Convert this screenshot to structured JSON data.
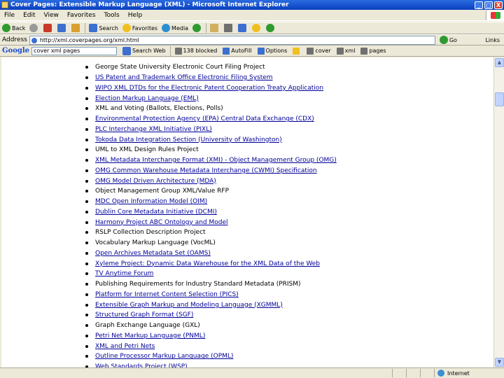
{
  "window": {
    "title": "Cover Pages: Extensible Markup Language (XML) - Microsoft Internet Explorer",
    "minimize": "_",
    "maximize": "□",
    "close": "X"
  },
  "menu": [
    "File",
    "Edit",
    "View",
    "Favorites",
    "Tools",
    "Help"
  ],
  "toolbar": {
    "back": "Back",
    "search": "Search",
    "favorites": "Favorites",
    "media": "Media"
  },
  "address": {
    "label": "Address",
    "url": "http://xml.coverpages.org/xml.html",
    "go": "Go",
    "links": "Links"
  },
  "google": {
    "logo": "Google",
    "query": "cover xml pages",
    "search_web": "Search Web",
    "blocked": "138 blocked",
    "autofill": "AutoFill",
    "options": "Options",
    "word1": "cover",
    "word2": "xml",
    "word3": "pages"
  },
  "links": [
    {
      "text": "George State University Electronic Court Filing Project",
      "linked": false
    },
    {
      "text": "US Patent and Trademark Office Electronic Filing System",
      "linked": true
    },
    {
      "text": "WIPO XML DTDs for the Electronic Patent Cooperation Treaty Application",
      "linked": true
    },
    {
      "text": "Election Markup Language (EML)",
      "linked": true
    },
    {
      "text": "XML and Voting (Ballots, Elections, Polls)",
      "linked": false
    },
    {
      "text": "Environmental Protection Agency (EPA) Central Data Exchange (CDX)",
      "linked": true
    },
    {
      "text": "PLC Interchange XML Initiative (PIXL)",
      "linked": true
    },
    {
      "text": "Tokoda Data Integration Section (University of Washington)",
      "linked": true
    },
    {
      "text": "UML to XML Design Rules Project",
      "linked": false
    },
    {
      "text": "XML Metadata Interchange Format (XMI) - Object Management Group (OMG)",
      "linked": true
    },
    {
      "text": "OMG Common Warehouse Metadata Interchange (CWMI) Specification",
      "linked": true
    },
    {
      "text": "OMG Model Driven Architecture (MDA)",
      "linked": true
    },
    {
      "text": "Object Management Group XML/Value RFP",
      "linked": false
    },
    {
      "text": "MDC Open Information Model (OIM)",
      "linked": true
    },
    {
      "text": "Dublin Core Metadata Initiative (DCMI)",
      "linked": true
    },
    {
      "text": "Harmony Project ABC Ontology and Model",
      "linked": true
    },
    {
      "text": "RSLP Collection Description Project",
      "linked": false
    },
    {
      "text": "Vocabulary Markup Language (VocML)",
      "linked": false
    },
    {
      "text": "Open Archives Metadata Set (OAMS)",
      "linked": true
    },
    {
      "text": "Xyleme Project: Dynamic Data Warehouse for the XML Data of the Web",
      "linked": true
    },
    {
      "text": "TV Anytime Forum",
      "linked": true
    },
    {
      "text": "Publishing Requirements for Industry Standard Metadata (PRISM)",
      "linked": false
    },
    {
      "text": "Platform for Internet Content Selection (PICS)",
      "linked": true
    },
    {
      "text": "Extensible Graph Markup and Modeling Language (XGMML)",
      "linked": true
    },
    {
      "text": "Structured Graph Format (SGF)",
      "linked": true
    },
    {
      "text": "Graph Exchange Language (GXL)",
      "linked": false
    },
    {
      "text": "Petri Net Markup Language (PNML)",
      "linked": true
    },
    {
      "text": "XML and Petri Nets",
      "linked": true
    },
    {
      "text": "Outline Processor Markup Language (OPML)",
      "linked": true
    },
    {
      "text": "Web Standards Project (WSP)",
      "linked": true
    }
  ],
  "status": {
    "zone": "Internet"
  }
}
